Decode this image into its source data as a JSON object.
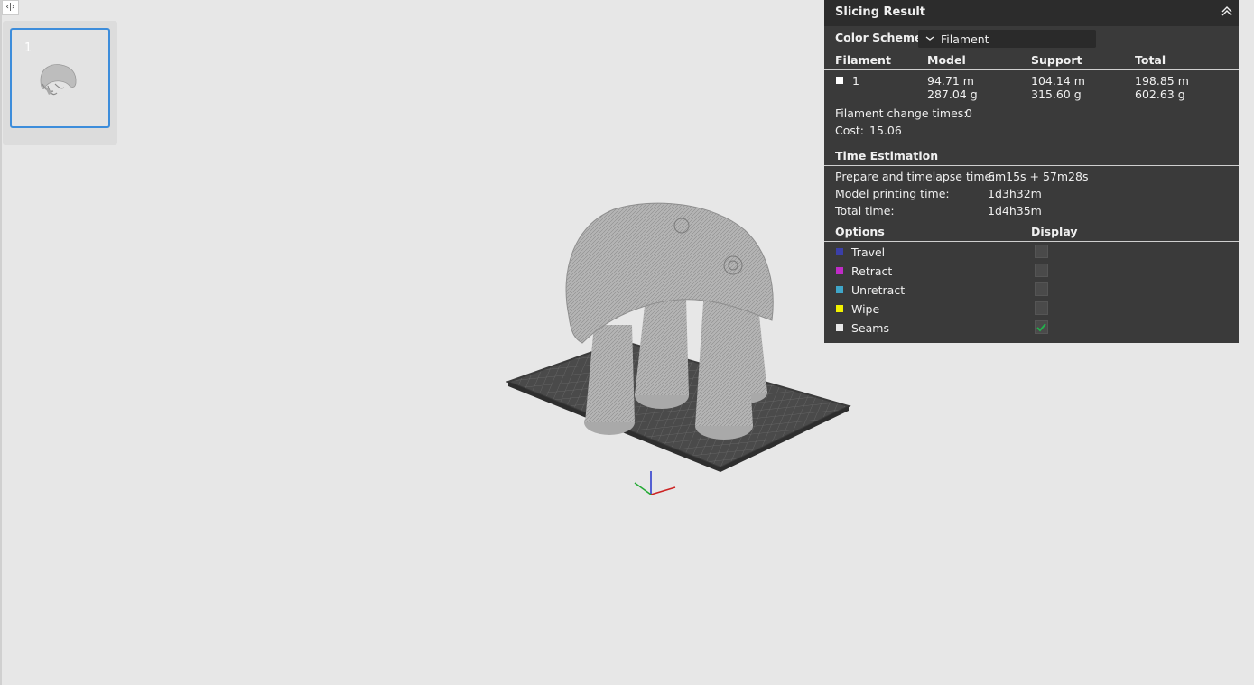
{
  "plate_sidebar": {
    "collapse_icon": "split-arrows-icon",
    "plates": [
      {
        "number": "1"
      }
    ]
  },
  "slicing_result": {
    "title": "Slicing Result",
    "collapse_icon": "double-chevron-up-icon",
    "color_scheme": {
      "label": "Color Scheme",
      "value": "Filament"
    },
    "filament_table": {
      "headers": [
        "Filament",
        "Model",
        "Support",
        "Total"
      ],
      "rows": [
        {
          "swatch_color": "#ffffff",
          "id": "1",
          "model_length": "94.71 m",
          "model_weight": "287.04 g",
          "support_length": "104.14 m",
          "support_weight": "315.60 g",
          "total_length": "198.85 m",
          "total_weight": "602.63 g"
        }
      ]
    },
    "filament_change": {
      "label": "Filament change times:",
      "value": "0"
    },
    "cost": {
      "label": "Cost:",
      "value": "15.06"
    },
    "time_estimation": {
      "title": "Time Estimation",
      "rows": [
        {
          "label": "Prepare and timelapse time:",
          "value": "6m15s + 57m28s"
        },
        {
          "label": "Model printing time:",
          "value": "1d3h32m"
        },
        {
          "label": "Total time:",
          "value": "1d4h35m"
        }
      ]
    },
    "options": {
      "headers": [
        "Options",
        "Display"
      ],
      "items": [
        {
          "label": "Travel",
          "color": "#3b3fa8",
          "checked": false
        },
        {
          "label": "Retract",
          "color": "#c02bc7",
          "checked": false
        },
        {
          "label": "Unretract",
          "color": "#3fa6c9",
          "checked": false
        },
        {
          "label": "Wipe",
          "color": "#f2f200",
          "checked": false
        },
        {
          "label": "Seams",
          "color": "#e8e8e8",
          "checked": true
        }
      ]
    }
  }
}
